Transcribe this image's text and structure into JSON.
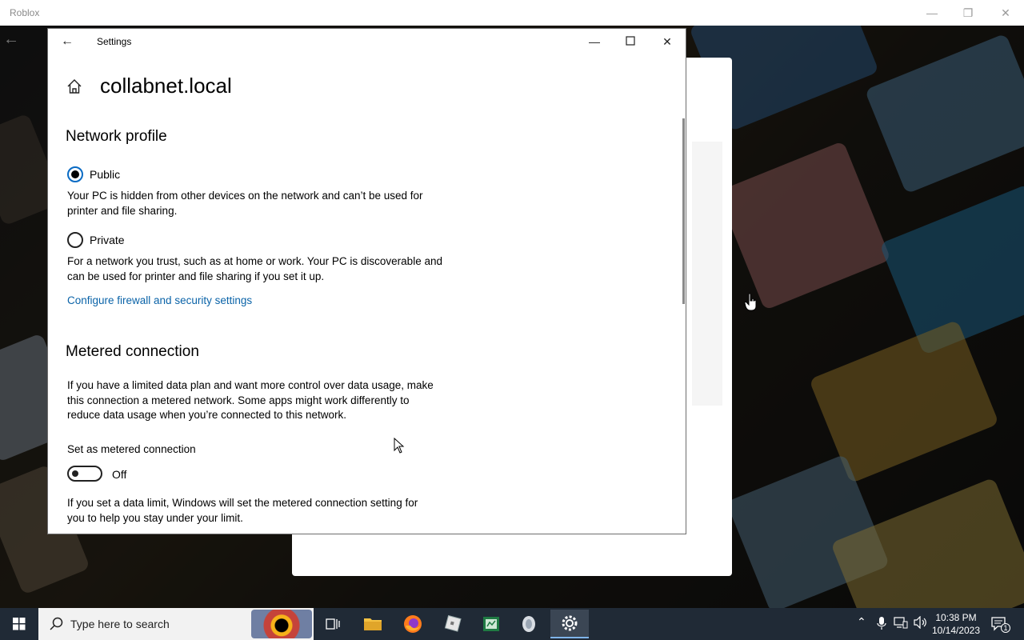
{
  "roblox": {
    "title": "Roblox"
  },
  "settings": {
    "window_title": "Settings",
    "page_title": "collabnet.local",
    "network_profile": {
      "heading": "Network profile",
      "public_label": "Public",
      "public_desc": "Your PC is hidden from other devices on the network and can’t be used for printer and file sharing.",
      "private_label": "Private",
      "private_desc": "For a network you trust, such as at home or work. Your PC is discoverable and can be used for printer and file sharing if you set it up.",
      "selected": "Public",
      "firewall_link": "Configure firewall and security settings"
    },
    "metered": {
      "heading": "Metered connection",
      "desc": "If you have a limited data plan and want more control over data usage, make this connection a metered network. Some apps might work differently to reduce data usage when you’re connected to this network.",
      "toggle_label": "Set as metered connection",
      "toggle_state": "Off",
      "limit_desc": "If you set a data limit, Windows will set the metered connection setting for you to help you stay under your limit."
    }
  },
  "taskbar": {
    "search_placeholder": "Type here to search",
    "time": "10:38 PM",
    "date": "10/14/2023",
    "notification_count": "1",
    "apps": [
      "task-view",
      "file-explorer",
      "firefox",
      "roblox-studio",
      "spreadsheet-app",
      "roblox-player",
      "settings"
    ]
  },
  "colors": {
    "accent": "#0a6bc4",
    "link": "#0a63a8",
    "taskbar": "#202a36"
  }
}
